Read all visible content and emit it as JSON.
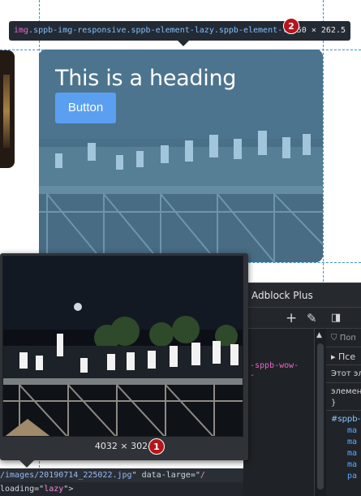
{
  "element_tooltip": {
    "tag": "img",
    "classes": ".sppb-img-responsive.sppb-element-lazy.sppb-element-loaded",
    "dimensions": "350 × 262.5",
    "badge": "2"
  },
  "card": {
    "heading": "This is a heading",
    "button_label": "Button"
  },
  "image_preview": {
    "dimensions": "4032 × 3024",
    "badge": "1"
  },
  "devtools": {
    "active_tab": "Adblock Plus",
    "toolbar_icons": [
      "plus-icon",
      "eyedropper-icon",
      "layout-icon"
    ],
    "code_lines": [
      "-sppb-wow-",
      "-"
    ],
    "side": {
      "filter_placeholder": "Поп",
      "pseudo_label": "Псе",
      "element_text": "Этот эл",
      "element_rule": "элемен",
      "brace": "}",
      "selector": "#sppb-",
      "props": [
        "ma",
        "ma",
        "ma",
        "ma",
        "pa"
      ]
    }
  },
  "source": {
    "line1": {
      "path": "/images/20190714_225022.jpg",
      "attr": "data-large",
      "value_start": "/"
    },
    "line2": {
      "attr": "loading",
      "value": "lazy"
    }
  },
  "colors": {
    "accent_blue": "#5b9ff0",
    "tooltip_bg": "#242a33",
    "badge_red": "#b5151b",
    "tag_pink": "#e36bc9",
    "class_blue": "#7fc1ff"
  }
}
